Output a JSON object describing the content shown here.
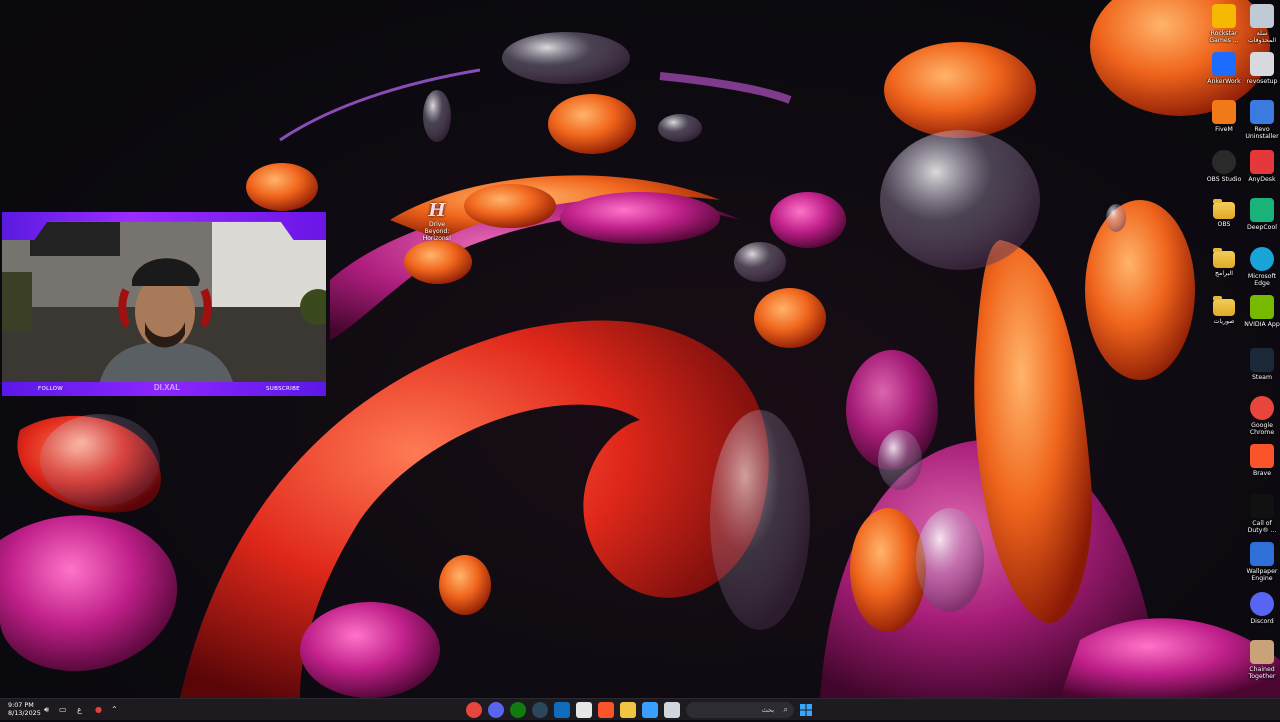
{
  "desktop_icons": [
    {
      "label": "Rockstar Games ...",
      "icon": "rockstar-icon",
      "color": "#f5b800"
    },
    {
      "label": "سلة المحذوفات",
      "icon": "recycle-bin-icon",
      "color": "#bfcad6"
    },
    {
      "label": "AnkerWork",
      "icon": "ankerwork-icon",
      "color": "#1e6bff"
    },
    {
      "label": "revosetup",
      "icon": "revo-setup-icon",
      "color": "#d8d8e0"
    },
    {
      "label": "FiveM",
      "icon": "fivem-icon",
      "color": "#f07a1a"
    },
    {
      "label": "Revo Uninstaller",
      "icon": "revo-uninstaller-icon",
      "color": "#3b7be0"
    },
    {
      "label": "OBS Studio",
      "icon": "obs-icon",
      "color": "#2a2a2a"
    },
    {
      "label": "AnyDesk",
      "icon": "anydesk-icon",
      "color": "#e5383b"
    },
    {
      "label": "OBS",
      "icon": "folder-icon",
      "color": "#e8b83b"
    },
    {
      "label": "DeepCool",
      "icon": "deepcool-icon",
      "color": "#19b37a"
    },
    {
      "label": "البرامج",
      "icon": "folder-icon",
      "color": "#e8b83b"
    },
    {
      "label": "Microsoft Edge",
      "icon": "edge-icon",
      "color": "#19a4d8"
    },
    {
      "label": "صوريات",
      "icon": "folder-icon",
      "color": "#e8b83b"
    },
    {
      "label": "NVIDIA App",
      "icon": "nvidia-icon",
      "color": "#76b900"
    },
    {
      "label": "Steam",
      "icon": "steam-icon",
      "color": "#1b2838"
    },
    {
      "label": "Google Chrome",
      "icon": "chrome-icon",
      "color": "#e8453c"
    },
    {
      "label": "Brave",
      "icon": "brave-icon",
      "color": "#fb542b"
    },
    {
      "label": "Call of Duty® ...",
      "icon": "call-of-duty-icon",
      "color": "#111111"
    },
    {
      "label": "Wallpaper Engine",
      "icon": "wallpaper-engine-icon",
      "color": "#2f6fd8"
    },
    {
      "label": "Discord",
      "icon": "discord-icon",
      "color": "#5865f2"
    },
    {
      "label": "Chained Together",
      "icon": "chained-together-icon",
      "color": "#c9a27a"
    }
  ],
  "center_shortcut": {
    "logo": "H",
    "label": "Drive Beyond: Horizons!"
  },
  "webcam": {
    "left_button": "FOLLOW",
    "right_button": "SUBSCRIBE",
    "name": "DI.XAL"
  },
  "taskbar": {
    "time": "9:07 PM",
    "date": "8/13/2025",
    "language": "ع",
    "search_placeholder": "بحث",
    "pinned": [
      {
        "icon": "chrome-icon",
        "color": "#e8453c"
      },
      {
        "icon": "discord-icon",
        "color": "#5865f2"
      },
      {
        "icon": "xbox-icon",
        "color": "#107c10"
      },
      {
        "icon": "steam-icon",
        "color": "#2a475e"
      },
      {
        "icon": "outlook-icon",
        "color": "#0f6cbd"
      },
      {
        "icon": "calendar-icon",
        "color": "#e6e6e6"
      },
      {
        "icon": "brave-icon",
        "color": "#fb542b"
      },
      {
        "icon": "file-explorer-icon",
        "color": "#f3c344"
      },
      {
        "icon": "copilot-icon",
        "color": "#3aa0ff"
      },
      {
        "icon": "notepad-icon",
        "color": "#cfd6de"
      }
    ]
  },
  "colors": {
    "accent": "#7b1fff",
    "taskbar": "#1d1b20"
  }
}
